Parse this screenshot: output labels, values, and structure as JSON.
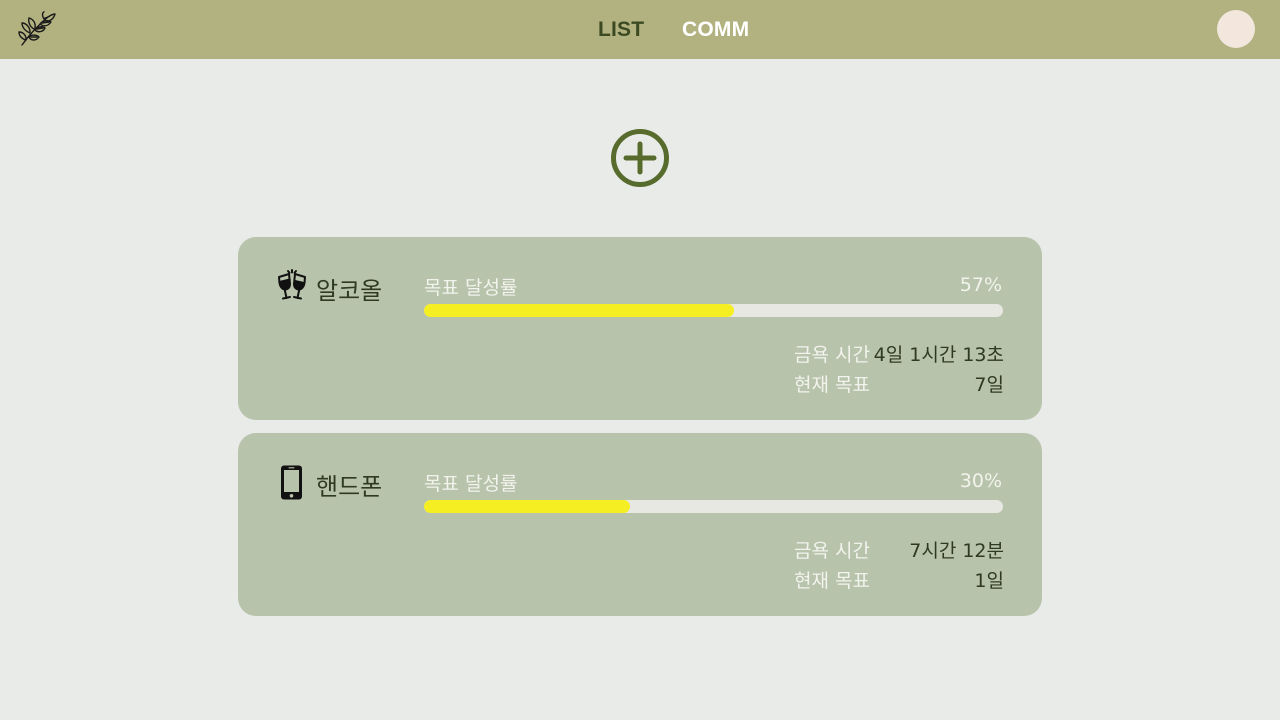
{
  "nav": {
    "list_label": "LIST",
    "comm_label": "COMM"
  },
  "colors": {
    "topbar": "#b2b281",
    "background": "#e9ebe9",
    "card": "#b8c3ab",
    "progress_fill": "#f4ee22",
    "progress_track": "#e8e8e3",
    "add_icon": "#566b2c",
    "avatar": "#f3e7dd"
  },
  "icons": {
    "logo": "leaf-branch-icon",
    "add": "plus-circle-icon"
  },
  "goals": [
    {
      "icon": "clinking-glasses-icon",
      "name": "알코올",
      "rate_label": "목표 달성률",
      "rate_text": "57%",
      "progress": 0.535,
      "time_label": "금욕 시간",
      "time_value": "4일 1시간 13초",
      "target_label": "현재 목표",
      "target_value": "7일"
    },
    {
      "icon": "smartphone-icon",
      "name": "핸드폰",
      "rate_label": "목표 달성률",
      "rate_text": "30%",
      "progress": 0.355,
      "time_label": "금욕 시간",
      "time_value": "7시간 12분",
      "target_label": "현재 목표",
      "target_value": "1일"
    }
  ]
}
